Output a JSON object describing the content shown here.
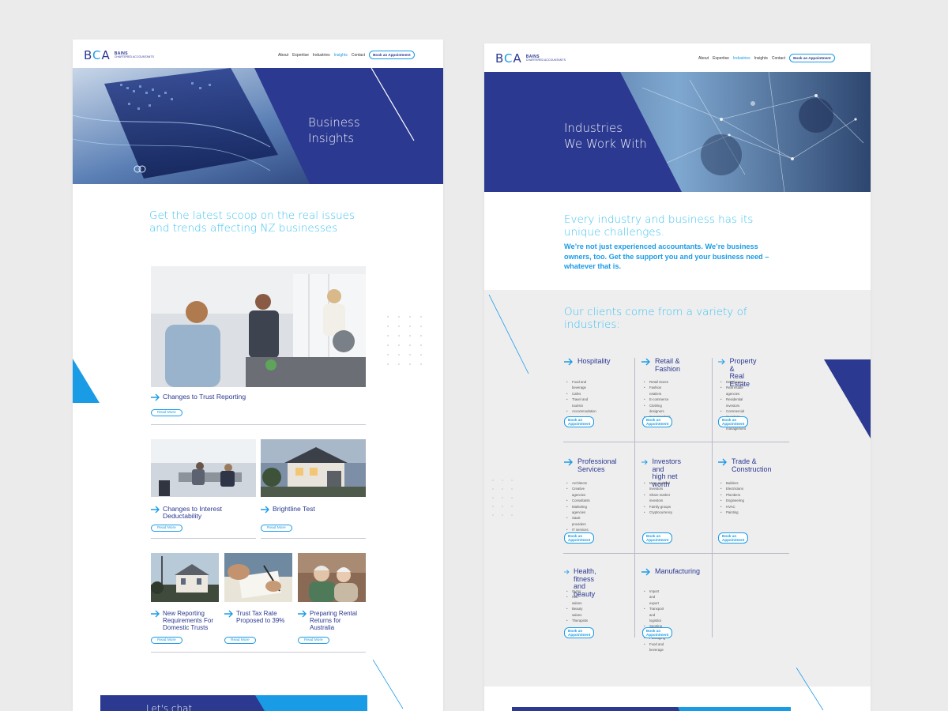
{
  "colors": {
    "navy": "#2b3990",
    "blue": "#1a9be6",
    "cyan": "#3cc3f0",
    "grey_band": "#eeeeef"
  },
  "brand": {
    "mark": "BCA",
    "name": "BAINS",
    "tagline": "CHARTERED ACCOUNTANTS"
  },
  "nav": {
    "items": [
      "About",
      "Expertise",
      "Industries",
      "Insights",
      "Contact"
    ],
    "cta": "Book an Appointment"
  },
  "left": {
    "active_nav": "Insights",
    "hero_title_line1": "Business",
    "hero_title_line2": "Insights",
    "lead_line1": "Get the latest scoop on the real issues",
    "lead_line2": "and trends affecting NZ businesses",
    "read_more": "Read More",
    "articles": [
      {
        "title": "Changes to Trust Reporting"
      },
      {
        "title": "Changes to Interest Deductability"
      },
      {
        "title": "Brightline Test"
      },
      {
        "title": "New Reporting Requirements For Domestic Trusts"
      },
      {
        "title": "Trust Tax Rate Proposed to 39%"
      },
      {
        "title": "Preparing Rental Returns for Australia"
      }
    ],
    "footer_banner": "Let's chat"
  },
  "right": {
    "active_nav": "Industries",
    "hero_title_line1": "Industries",
    "hero_title_line2": "We Work With",
    "lead_line1": "Every industry and business has its",
    "lead_line2": "unique challenges.",
    "sub_line1": "We’re not just experienced accountants. We’re business",
    "sub_line2": "owners, too. Get the support you and your business need –",
    "sub_line3": "whatever that is.",
    "clients_line1": "Our clients come from a variety of",
    "clients_line2": "industries:",
    "book": "Book an Appointment",
    "industries": [
      {
        "title1": "Hospitality",
        "title2": "",
        "items": [
          "Food and beverage",
          "Cafes",
          "Travel and tourism",
          "Accommodation"
        ]
      },
      {
        "title1": "Retail &",
        "title2": "Fashion",
        "items": [
          "Retail stores",
          "Fashion retailers",
          "E-commerce",
          "Clothing designers",
          "Supermarkets"
        ]
      },
      {
        "title1": "Property &",
        "title2": "Real Estate",
        "items": [
          "Developers",
          "Real estate agencies",
          "Residential investors",
          "Commercial investors",
          "Property management"
        ]
      },
      {
        "title1": "Professional",
        "title2": "Services",
        "items": [
          "Architects",
          "Creative agencies",
          "Consultants",
          "Marketing agencies",
          "SaaS providers",
          "IT services",
          "Healthcare professionals"
        ]
      },
      {
        "title1": "Investors and",
        "title2": "high net worth",
        "items": [
          "Mum and dad investors",
          "Share market investors",
          "Family groups",
          "Cryptocurrency"
        ]
      },
      {
        "title1": "Trade &",
        "title2": "Construction",
        "items": [
          "Builders",
          "Electricians",
          "Plumbers",
          "Engineering",
          "HVAC",
          "Painting"
        ]
      },
      {
        "title1": "Health, fitness",
        "title2": "and beauty",
        "items": [
          "Gyms",
          "Hair salons",
          "Beauty salons",
          "Therapists"
        ]
      },
      {
        "title1": "Manufacturing",
        "title2": "",
        "items": [
          "Import and export",
          "Transport and logistics",
          "Sporting goods",
          "Packaging",
          "Food and beverage"
        ]
      }
    ]
  }
}
